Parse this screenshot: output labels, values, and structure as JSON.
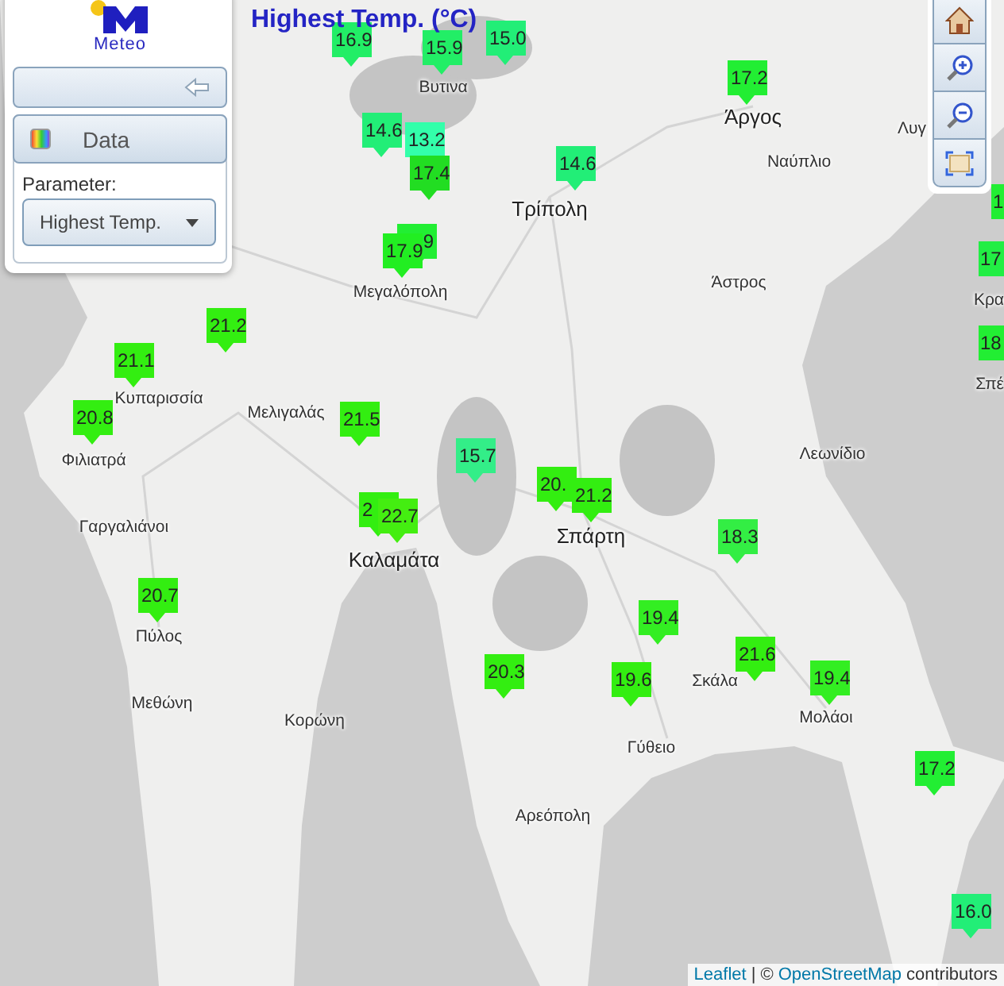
{
  "title": "Highest Temp. (°C)",
  "panel": {
    "logo_text": "Meteo",
    "section": "Data",
    "parameter_label": "Parameter:",
    "parameter_value": "Highest Temp."
  },
  "map": {
    "places": [
      {
        "name": "Βυτινα",
        "kind": "town"
      },
      {
        "name": "Άργος",
        "kind": "city"
      },
      {
        "name": "Λυγ",
        "kind": "town"
      },
      {
        "name": "Ναύπλιο",
        "kind": "town"
      },
      {
        "name": "Τρίπολη",
        "kind": "city"
      },
      {
        "name": "Μεγαλόπολη",
        "kind": "town"
      },
      {
        "name": "Άστρος",
        "kind": "town"
      },
      {
        "name": "Κρα",
        "kind": "town"
      },
      {
        "name": "Σπέ",
        "kind": "town"
      },
      {
        "name": "Κυπαρισσία",
        "kind": "town"
      },
      {
        "name": "Μελιγαλάς",
        "kind": "town"
      },
      {
        "name": "Φιλιατρά",
        "kind": "town"
      },
      {
        "name": "Λεωνίδιο",
        "kind": "town"
      },
      {
        "name": "Γαργαλιάνοι",
        "kind": "town"
      },
      {
        "name": "Καλαμάτα",
        "kind": "city"
      },
      {
        "name": "Σπάρτη",
        "kind": "city"
      },
      {
        "name": "Πύλος",
        "kind": "town"
      },
      {
        "name": "Μεθώνη",
        "kind": "town"
      },
      {
        "name": "Κορώνη",
        "kind": "town"
      },
      {
        "name": "Σκάλα",
        "kind": "town"
      },
      {
        "name": "Μολάοι",
        "kind": "town"
      },
      {
        "name": "Γύθειο",
        "kind": "town"
      },
      {
        "name": "Αρεόπολη",
        "kind": "town"
      }
    ],
    "markers": [
      {
        "value": "16.9",
        "color": "#22ee66"
      },
      {
        "value": "15.9",
        "color": "#22ee66"
      },
      {
        "value": "15.0",
        "color": "#22ee77"
      },
      {
        "value": "17.2",
        "color": "#22ee33"
      },
      {
        "value": "14.6",
        "color": "#22ee77"
      },
      {
        "value": "13.2",
        "color": "#33ffaa"
      },
      {
        "value": "17.4",
        "color": "#22dd22"
      },
      {
        "value": "14.6",
        "color": "#22ee77"
      },
      {
        "value": "1",
        "color": "#22ee33"
      },
      {
        "value": "9",
        "color": "#22ee33"
      },
      {
        "value": "17.9",
        "color": "#22ee22"
      },
      {
        "value": "17",
        "color": "#22ee44"
      },
      {
        "value": "18",
        "color": "#22ee33"
      },
      {
        "value": "21.2",
        "color": "#33ee11"
      },
      {
        "value": "21.1",
        "color": "#33ee11"
      },
      {
        "value": "20.8",
        "color": "#33ee11"
      },
      {
        "value": "21.5",
        "color": "#33ee11"
      },
      {
        "value": "15.7",
        "color": "#33ee88"
      },
      {
        "value": "20.",
        "color": "#33ee11"
      },
      {
        "value": "21.2",
        "color": "#33ee11"
      },
      {
        "value": "2",
        "color": "#33ee11"
      },
      {
        "value": "22.7",
        "color": "#44ee11"
      },
      {
        "value": "18.3",
        "color": "#33ee44"
      },
      {
        "value": "20.7",
        "color": "#33ee11"
      },
      {
        "value": "19.4",
        "color": "#33ee22"
      },
      {
        "value": "20.3",
        "color": "#33ee11"
      },
      {
        "value": "19.6",
        "color": "#33ee11"
      },
      {
        "value": "21.6",
        "color": "#33ee11"
      },
      {
        "value": "19.4",
        "color": "#33ee22"
      },
      {
        "value": "17.2",
        "color": "#22ee33"
      },
      {
        "value": "16.0",
        "color": "#22ee77"
      }
    ]
  },
  "attribution": [
    {
      "kind": "link",
      "text": "Leaflet"
    },
    {
      "kind": "text",
      "text": "| ©"
    },
    {
      "kind": "link",
      "text": "OpenStreetMap"
    },
    {
      "kind": "text",
      "text": "contributors"
    }
  ]
}
